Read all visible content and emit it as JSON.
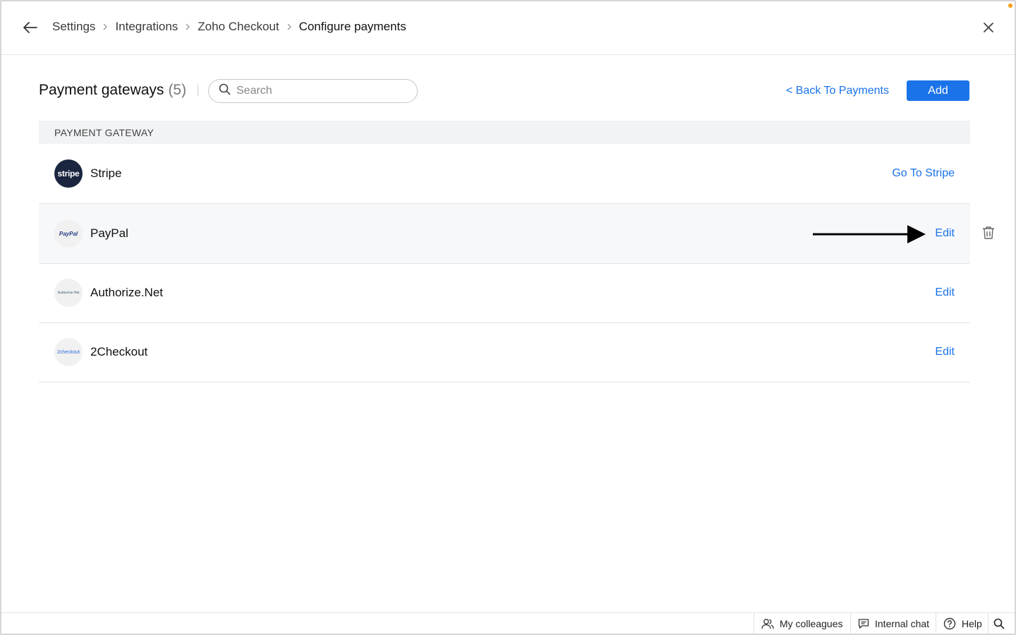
{
  "header": {
    "breadcrumbs": [
      "Settings",
      "Integrations",
      "Zoho Checkout",
      "Configure payments"
    ],
    "back_icon": "arrow-left-icon",
    "close_icon": "close-icon"
  },
  "toolbar": {
    "title": "Payment gateways",
    "count": "(5)",
    "search_placeholder": "Search",
    "back_link": "< Back To Payments",
    "add_label": "Add"
  },
  "table": {
    "header": "PAYMENT GATEWAY",
    "rows": [
      {
        "name": "Stripe",
        "logo_text": "stripe",
        "action": "Go To Stripe"
      },
      {
        "name": "PayPal",
        "logo_text": "PayPal",
        "action": "Edit"
      },
      {
        "name": "Authorize.Net",
        "logo_text": "Authorize.Net",
        "action": "Edit"
      },
      {
        "name": "2Checkout",
        "logo_text": "2checkout",
        "action": "Edit"
      }
    ]
  },
  "bottombar": {
    "colleagues": "My colleagues",
    "chat": "Internal chat",
    "help": "Help"
  },
  "colors": {
    "accent": "#1a73e8",
    "notification_dot": "#f39c12"
  }
}
